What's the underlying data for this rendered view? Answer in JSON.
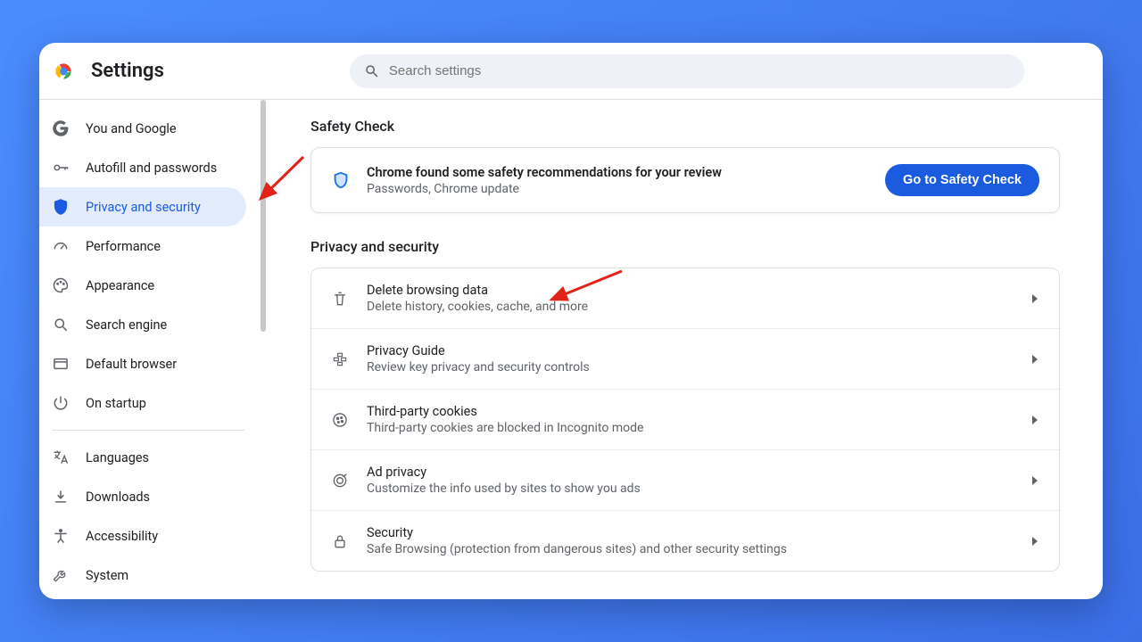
{
  "header": {
    "title": "Settings",
    "search_placeholder": "Search settings"
  },
  "sidebar": {
    "group1": [
      {
        "icon": "google",
        "label": "You and Google"
      },
      {
        "icon": "key",
        "label": "Autofill and passwords"
      },
      {
        "icon": "shield",
        "label": "Privacy and security",
        "active": true
      },
      {
        "icon": "speed",
        "label": "Performance"
      },
      {
        "icon": "palette",
        "label": "Appearance"
      },
      {
        "icon": "search",
        "label": "Search engine"
      },
      {
        "icon": "browser",
        "label": "Default browser"
      },
      {
        "icon": "power",
        "label": "On startup"
      }
    ],
    "group2": [
      {
        "icon": "translate",
        "label": "Languages"
      },
      {
        "icon": "download",
        "label": "Downloads"
      },
      {
        "icon": "accessibility",
        "label": "Accessibility"
      },
      {
        "icon": "wrench",
        "label": "System"
      }
    ]
  },
  "main": {
    "safety_check": {
      "heading": "Safety Check",
      "title": "Chrome found some safety recommendations for your review",
      "subtitle": "Passwords, Chrome update",
      "button": "Go to Safety Check"
    },
    "privacy": {
      "heading": "Privacy and security",
      "items": [
        {
          "icon": "trash",
          "title": "Delete browsing data",
          "subtitle": "Delete history, cookies, cache, and more"
        },
        {
          "icon": "guide",
          "title": "Privacy Guide",
          "subtitle": "Review key privacy and security controls"
        },
        {
          "icon": "cookie",
          "title": "Third-party cookies",
          "subtitle": "Third-party cookies are blocked in Incognito mode"
        },
        {
          "icon": "target",
          "title": "Ad privacy",
          "subtitle": "Customize the info used by sites to show you ads"
        },
        {
          "icon": "lock",
          "title": "Security",
          "subtitle": "Safe Browsing (protection from dangerous sites) and other security settings"
        }
      ]
    }
  }
}
